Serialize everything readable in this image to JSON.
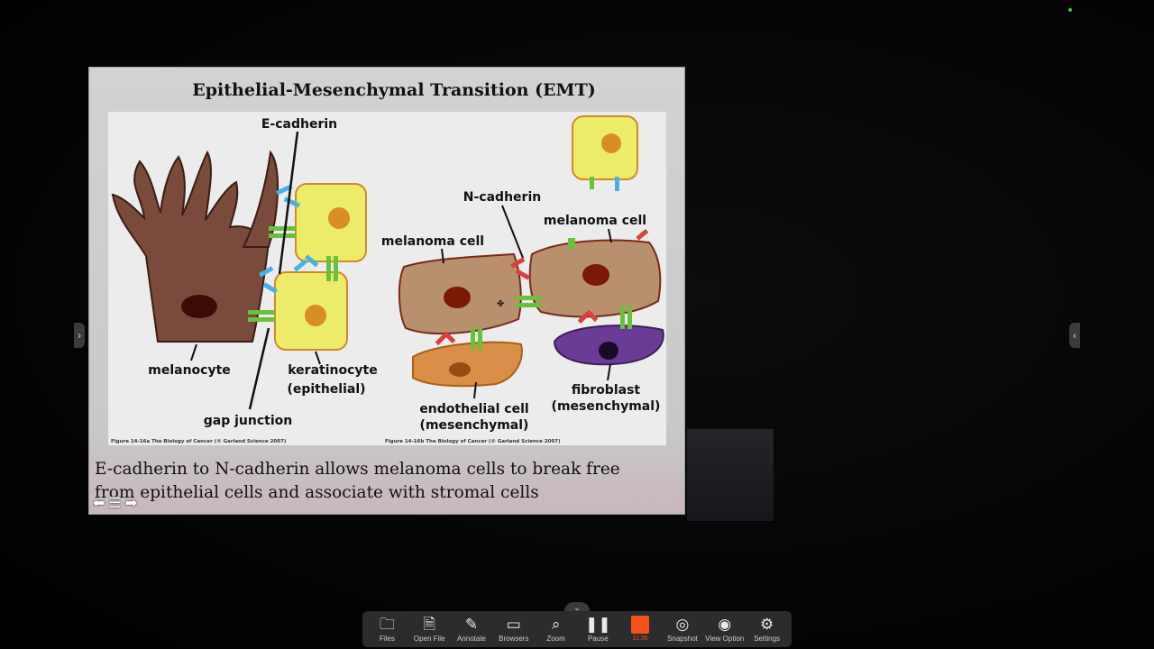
{
  "slide": {
    "title": "Epithelial-Mesenchymal Transition (EMT)",
    "caption_line1": "E-cadherin to N-cadherin allows melanoma cells to break free",
    "caption_line2": "from epithelial cells and associate with stromal cells",
    "figure": {
      "labels": {
        "e_cadherin": "E-cadherin",
        "melanocyte": "melanocyte",
        "keratinocyte_line1": "keratinocyte",
        "keratinocyte_line2": "(epithelial)",
        "gap_junction": "gap junction",
        "n_cadherin": "N-cadherin",
        "melanoma_cell_left": "melanoma cell",
        "melanoma_cell_right": "melanoma cell",
        "endothelial_line1": "endothelial cell",
        "endothelial_line2": "(mesenchymal)",
        "fibroblast_line1": "fibroblast",
        "fibroblast_line2": "(mesenchymal)"
      },
      "credit_left": "Figure 14-16a  The Biology of Cancer (© Garland Science 2007)",
      "credit_right": "Figure 14-16b  The Biology of Cancer (© Garland Science 2007)"
    },
    "nav": {
      "prev_icon": "arrow-left-icon",
      "list_icon": "list-icon",
      "next_icon": "arrow-right-icon"
    }
  },
  "toolbar": {
    "items": [
      {
        "label": "Files",
        "icon": "folder-icon"
      },
      {
        "label": "Open File",
        "icon": "document-icon"
      },
      {
        "label": "Annotate",
        "icon": "pen-icon"
      },
      {
        "label": "Browsers",
        "icon": "browser-icon"
      },
      {
        "label": "Zoom",
        "icon": "magnifier-icon"
      },
      {
        "label": "Pause",
        "icon": "pause-icon"
      },
      {
        "label": "11:36",
        "icon": "record-icon"
      },
      {
        "label": "Snapshot",
        "icon": "camera-icon"
      },
      {
        "label": "View Option",
        "icon": "eye-icon"
      },
      {
        "label": "Settings",
        "icon": "gear-icon"
      }
    ]
  },
  "colors": {
    "melanocyte": "#7a4a3c",
    "keratinocyte": "#ecec6a",
    "melanoma": "#b8906e",
    "endothelial": "#d98f47",
    "fibroblast": "#6a3c96",
    "e_cadherin": "#4ab0e0",
    "gap_junction": "#6bbf3a",
    "n_cadherin": "#d94040",
    "record": "#f4511e"
  }
}
